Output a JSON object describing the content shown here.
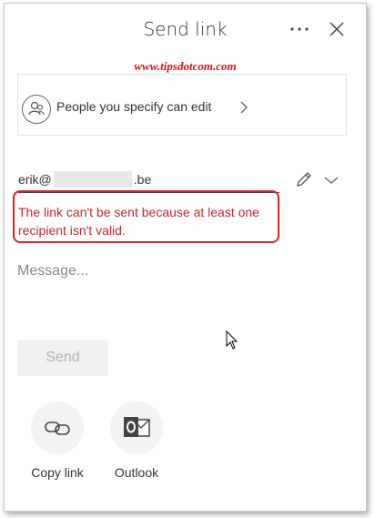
{
  "dialog": {
    "title": "Send link",
    "more_icon": "ellipsis-icon",
    "close_icon": "close-icon"
  },
  "watermark": "www.tipsdotcom.com",
  "permission": {
    "label": "People you specify can edit",
    "icon": "people-icon",
    "chevron_icon": "chevron-right-icon"
  },
  "recipient": {
    "prefix": "erik@",
    "suffix": ".be",
    "edit_icon": "pencil-icon",
    "dropdown_icon": "chevron-down-icon"
  },
  "error": {
    "message": "The link can't be sent because at least one recipient isn't valid.",
    "color": "#c4262e",
    "highlight_color": "#e02020"
  },
  "message_field": {
    "placeholder": "Message..."
  },
  "send_button": {
    "label": "Send",
    "enabled": false
  },
  "share_options": [
    {
      "label": "Copy link",
      "icon": "link-icon"
    },
    {
      "label": "Outlook",
      "icon": "outlook-icon"
    }
  ]
}
